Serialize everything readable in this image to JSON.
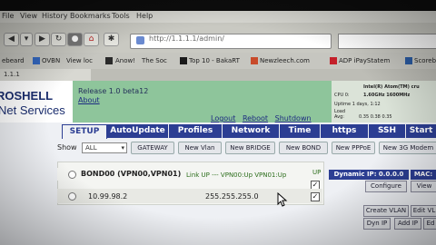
{
  "browser": {
    "menu": [
      "File",
      "View",
      "History",
      "Bookmarks",
      "Tools",
      "Help"
    ],
    "url": "http://1.1.1.1/admin/",
    "bookmarks": [
      "ebeard",
      "OVBN",
      "View loc",
      "Anow!",
      "The Soc",
      "Top 10 - BakaRT",
      "Newzleech.com",
      "ADP iPayStatem",
      "Scoreb"
    ],
    "tab_title": "1.1.1"
  },
  "header": {
    "logo_line1": "ROSHELL",
    "logo_line2": "Net Services",
    "release": "Release 1.0 beta12",
    "about": "About",
    "links": [
      "Logout",
      "Reboot",
      "Shutdown"
    ]
  },
  "sysinfo": {
    "cpu": "Intel(R) Atom(TM) cru",
    "cpu_label": "CPU 0:",
    "speed": "1.60GHz 1600MHz",
    "uptime": "Uptime 1 days, 1:12",
    "load_label": "Load",
    "load_label2": "Avg:",
    "load": "0.35 0.38 0.35"
  },
  "tabs": [
    "SETUP",
    "AutoUpdate",
    "Profiles",
    "Network",
    "Time",
    "https",
    "SSH",
    "Start"
  ],
  "toolbar": {
    "show_label": "Show",
    "show_value": "ALL",
    "buttons": [
      "GATEWAY",
      "New Vlan",
      "New BRIDGE",
      "New BOND",
      "New PPPoE",
      "New 3G Modem"
    ]
  },
  "interfaces": {
    "bond_name": "BOND00 (VPN00,VPN01)",
    "bond_status": "Link UP --- VPN00:Up VPN01:Up",
    "up_header": "UP",
    "ip": "10.99.98.2",
    "mask": "255.255.255.0",
    "check": "✓"
  },
  "rightpanel": {
    "dynamic_ip": "Dynamic IP: 0.0.0.0",
    "mac": "MAC:",
    "configure": "Configure",
    "view": "View",
    "create_vlan": "Create VLAN",
    "edit_vlan": "Edit VL",
    "dyn_ip": "Dyn IP",
    "add_ip": "Add IP",
    "ed": "Ed"
  }
}
